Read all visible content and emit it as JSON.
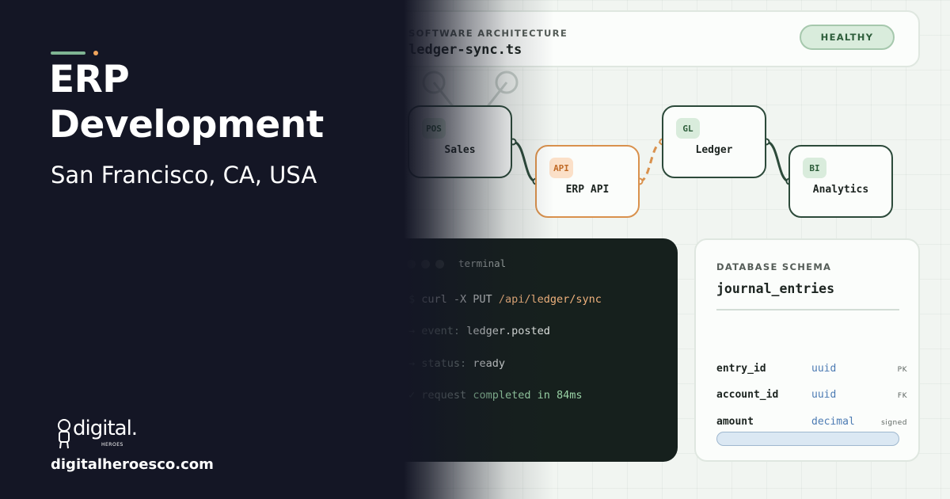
{
  "header": {
    "eyebrow": "SOFTWARE ARCHITECTURE",
    "filename": "ledger-sync.ts",
    "status": "HEALTHY"
  },
  "nodes": [
    {
      "tag": "POS",
      "label": "Sales"
    },
    {
      "tag": "API",
      "label": "ERP API"
    },
    {
      "tag": "GL",
      "label": "Ledger"
    },
    {
      "tag": "BI",
      "label": "Analytics"
    }
  ],
  "terminal": {
    "title": "terminal",
    "lines": [
      {
        "prefix": "$",
        "text": "curl -X PUT",
        "highlight": "/api/ledger/sync"
      },
      {
        "prefix": "→",
        "key": "event:",
        "value": "ledger.posted"
      },
      {
        "prefix": "→",
        "key": "status:",
        "value": "ready"
      },
      {
        "prefix": "✓",
        "key": "request",
        "value": "completed in 84ms"
      }
    ]
  },
  "schema": {
    "eyebrow": "DATABASE SCHEMA",
    "table": "journal_entries",
    "fields": [
      {
        "name": "entry_id",
        "type": "uuid",
        "key": "PK"
      },
      {
        "name": "account_id",
        "type": "uuid",
        "key": "FK"
      },
      {
        "name": "amount",
        "type": "decimal",
        "key": "signed"
      }
    ]
  },
  "hero": {
    "title_line1": "ERP",
    "title_line2": "Development",
    "location": "San Francisco, CA, USA"
  },
  "brand": {
    "logo_text": "digital.",
    "logo_sub": "HEROES",
    "website": "digitalheroesco.com"
  },
  "colors": {
    "dark_bg": "#141625",
    "accent_green": "#7fb493",
    "accent_orange": "#f0a45c",
    "node_border": "#2c4a3a",
    "active_border": "#d9914d"
  }
}
